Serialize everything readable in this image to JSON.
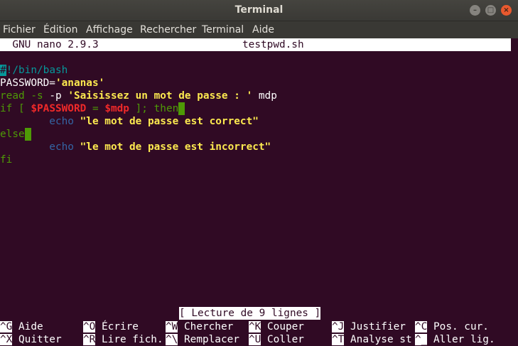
{
  "window": {
    "title": "Terminal",
    "minimize": "–",
    "maximize": "□",
    "close": "×"
  },
  "menu": [
    "Fichier",
    "Édition",
    "Affichage",
    "Rechercher",
    "Terminal",
    "Aide"
  ],
  "nano": {
    "version": "  GNU nano 2.9.3",
    "filename": "testpwd.sh"
  },
  "code": {
    "l1a": "#",
    "l1b": "!/bin/bash",
    "l2a": "PASSWORD=",
    "l2b": "'ananas'",
    "l3a": "read",
    "l3b": " -s ",
    "l3c": "-p ",
    "l3d": "'Saisissez un mot de passe : '",
    "l3e": " mdp",
    "l4a": "if [ ",
    "l4b": "$PASSWORD",
    "l4c": " = ",
    "l4d": "$mdp",
    "l4e": " ]; then",
    "l5a": "        echo ",
    "l5b": "\"le mot de passe est correct\"",
    "l6a": "else",
    "l7a": "        echo ",
    "l7b": "\"le mot de passe est incorrect\"",
    "l8a": "fi"
  },
  "status": "[ Lecture de 9 lignes ]",
  "shortcuts_row1": [
    {
      "key": "^G",
      "label": " Aide"
    },
    {
      "key": "^O",
      "label": " Écrire"
    },
    {
      "key": "^W",
      "label": " Chercher"
    },
    {
      "key": "^K",
      "label": " Couper"
    },
    {
      "key": "^J",
      "label": " Justifier"
    },
    {
      "key": "^C",
      "label": " Pos. cur."
    }
  ],
  "shortcuts_row2": [
    {
      "key": "^X",
      "label": " Quitter"
    },
    {
      "key": "^R",
      "label": " Lire fich."
    },
    {
      "key": "^\\",
      "label": " Remplacer"
    },
    {
      "key": "^U",
      "label": " Coller"
    },
    {
      "key": "^T",
      "label": " Analyse st"
    },
    {
      "key": "^_",
      "label": " Aller lig."
    }
  ]
}
